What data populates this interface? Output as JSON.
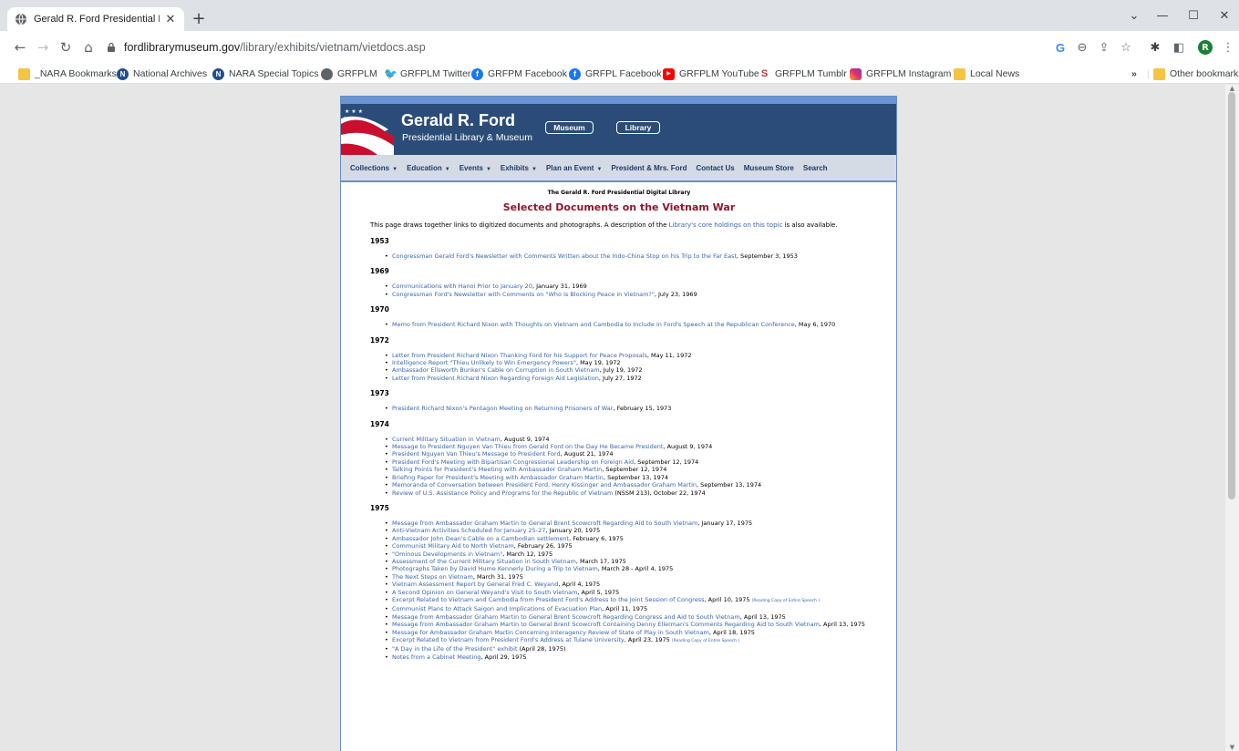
{
  "browser": {
    "tab_title": "Gerald R. Ford Presidential Librar",
    "url_host": "fordlibrarymuseum.gov",
    "url_path": "/library/exhibits/vietnam/vietdocs.asp",
    "profile_initial": "R"
  },
  "bookmarks": [
    {
      "label": "_NARA Bookmarks",
      "icon": "folder-icon"
    },
    {
      "label": "National Archives",
      "icon": "nara-logo-icon"
    },
    {
      "label": "NARA Special Topics",
      "icon": "nara-logo-icon"
    },
    {
      "label": "GRFPLM",
      "icon": "globe-icon"
    },
    {
      "label": "GRFPLM Twitter",
      "icon": "twitter-icon"
    },
    {
      "label": "GRFPM Facebook",
      "icon": "facebook-icon"
    },
    {
      "label": "GRFPL Facebook",
      "icon": "facebook-icon"
    },
    {
      "label": "GRFPLM YouTube",
      "icon": "youtube-icon"
    },
    {
      "label": "GRFPLM Tumblr",
      "icon": "tumblr-icon"
    },
    {
      "label": "GRFPLM Instagram",
      "icon": "instagram-icon"
    },
    {
      "label": "Local News",
      "icon": "folder-icon"
    }
  ],
  "bookmarks_overflow": "»",
  "other_bookmarks": "Other bookmarks",
  "site": {
    "brand_name": "Gerald R. Ford",
    "brand_sub": "Presidential Library & Museum",
    "pill_museum": "Museum",
    "pill_library": "Library",
    "nav": [
      {
        "label": "Collections",
        "caret": true
      },
      {
        "label": "Education",
        "caret": true
      },
      {
        "label": "Events",
        "caret": true
      },
      {
        "label": "Exhibits",
        "caret": true
      },
      {
        "label": "Plan an Event",
        "caret": true
      },
      {
        "label": "President & Mrs. Ford",
        "caret": false
      },
      {
        "label": "Contact Us",
        "caret": false
      },
      {
        "label": "Museum Store",
        "caret": false
      },
      {
        "label": "Search",
        "caret": false
      }
    ]
  },
  "content": {
    "kicker": "The Gerald R. Ford Presidential Digital Library",
    "title": "Selected Documents on the Vietnam War",
    "intro_before": "This page draws together links to digitized documents and photographs. A description of the ",
    "intro_link": "Library's core holdings on this topic",
    "intro_after": " is also available.",
    "years": [
      {
        "year": "1953",
        "items": [
          {
            "link": "Congressman Gerald Ford's Newsletter with Comments Written about the Indo-China Stop on his Trip to the Far East",
            "tail": ", September 3, 1953"
          }
        ]
      },
      {
        "year": "1969",
        "items": [
          {
            "link": "Communications with Hanoi Prior to January 20",
            "tail": ", January 31, 1969"
          },
          {
            "link": "Congressman Ford's Newsletter with Comments on \"Who is Blocking Peace in Vietnam?\"",
            "tail": ", July 23, 1969"
          }
        ]
      },
      {
        "year": "1970",
        "items": [
          {
            "link": "Memo from President Richard Nixon with Thoughts on Vietnam and Cambodia to Include in Ford's Speech at the Republican Conference",
            "tail": ", May 6, 1970"
          }
        ]
      },
      {
        "year": "1972",
        "items": [
          {
            "link": "Letter from President Richard Nixon Thanking Ford for his Support for Peace Proposals",
            "tail": ", May 11, 1972"
          },
          {
            "link": "Intelligence Report \"Thieu Unlikely to Win Emergency Powers\"",
            "tail": ", May 19, 1972"
          },
          {
            "link": "Ambassador Ellsworth Bunker's Cable on Corruption in South Vietnam",
            "tail": ", July 19, 1972"
          },
          {
            "link": "Letter from President Richard Nixon Regarding Foreign Aid Legislation",
            "tail": ", July 27, 1972"
          }
        ]
      },
      {
        "year": "1973",
        "items": [
          {
            "link": "President Richard Nixon's Pentagon Meeting on Returning Prisoners of War",
            "tail": ", February 15, 1973"
          }
        ]
      },
      {
        "year": "1974",
        "items": [
          {
            "link": "Current Military Situation in Vietnam",
            "tail": ", August 9, 1974"
          },
          {
            "link": "Message to President Nguyen Van Thieu from Gerald Ford on the Day He Became President",
            "tail": ", August 9, 1974"
          },
          {
            "link": "President Nguyen Van Thieu's Message to President Ford",
            "tail": ", August 21, 1974"
          },
          {
            "link": "President Ford's Meeting with Bipartisan Congressional Leadership on Foreign Aid",
            "tail": ", September 12, 1974"
          },
          {
            "link": "Talking Points for President's Meeting with Ambassador Graham Martin",
            "tail": ", September 12, 1974"
          },
          {
            "link": "Briefing Paper for President's Meeting with Ambassador Graham Martin",
            "tail": ", September 13, 1974"
          },
          {
            "link": "Memoranda of Conversation between President Ford, Henry Kissinger and Ambassador Graham Martin",
            "tail": ", September 13, 1974"
          },
          {
            "link": "Review of U.S. Assistance Policy and Programs for the Republic of Vietnam",
            "tail": " (NSSM 213), October 22, 1974"
          }
        ]
      },
      {
        "year": "1975",
        "items": [
          {
            "link": "Message from Ambassador Graham Martin to General Brent Scowcroft Regarding Aid to South Vietnam",
            "tail": ", January 17, 1975"
          },
          {
            "link": "Anti-Vietnam Activities Scheduled for January 25-27",
            "tail": ", January 20, 1975"
          },
          {
            "link": "Ambassador John Dean's Cable on a Cambodian settlement",
            "tail": ", February 6, 1975"
          },
          {
            "link": "Communist Military Aid to North Vietnam",
            "tail": ", February 26, 1975"
          },
          {
            "link": "\"Ominous Developments in Vietnam\"",
            "tail": ", March 12, 1975"
          },
          {
            "link": "Assessment of the Current Military Situation in South Vietnam",
            "tail": ", March 17, 1975"
          },
          {
            "link": "Photographs Taken by David Hume Kennerly During a Trip to Vietnam",
            "tail": ", March 28 - April 4, 1975"
          },
          {
            "link": "The Next Steps on Vietnam",
            "tail": ", March 31, 1975"
          },
          {
            "link": "Vietnam Assessment Report by General Fred C. Weyand",
            "tail": ", April 4, 1975"
          },
          {
            "link": "A Second Opinion on General Weyand's Visit to South Vietnam",
            "tail": ", April 5, 1975"
          },
          {
            "link": "Excerpt Related to Vietnam and Cambodia from President Ford's Address to the Joint Session of Congress",
            "tail": ", April 10, 1975 ",
            "small": "(Reading Copy of Entire Speech )"
          },
          {
            "link": "Communist Plans to Attack Saigon and Implications of Evacuation Plan",
            "tail": ", April 11, 1975"
          },
          {
            "link": "Message from Ambassador Graham Martin to General Brent Scowcroft Regarding Congress and Aid to South Vietnam",
            "tail": ", April 13, 1975"
          },
          {
            "link": "Message from Ambassador Graham Martin to General Brent Scowcroft Containing Denny Ellerman's Comments Regarding Aid to South Vietnam",
            "tail": ", April 13, 1975"
          },
          {
            "link": "Message for Ambassador Graham Martin Concerning Interagency Review of State of Play in South Vietnam",
            "tail": ", April 18, 1975"
          },
          {
            "link": "Excerpt Related to Vietnam from President Ford's Address at Tulane University",
            "tail": ", April 23, 1975 ",
            "small": "(Reading Copy of Entire Speech )"
          },
          {
            "link": "\"A Day in the Life of the President\" exhibit",
            "tail": " (April 28, 1975)"
          },
          {
            "link": "Notes from a Cabinet Meeting",
            "tail": ", April 29, 1975"
          }
        ]
      }
    ]
  },
  "colors": {
    "banner": "#2b4c79",
    "title_red": "#8b1a2e",
    "link_blue": "#3b66a8"
  }
}
